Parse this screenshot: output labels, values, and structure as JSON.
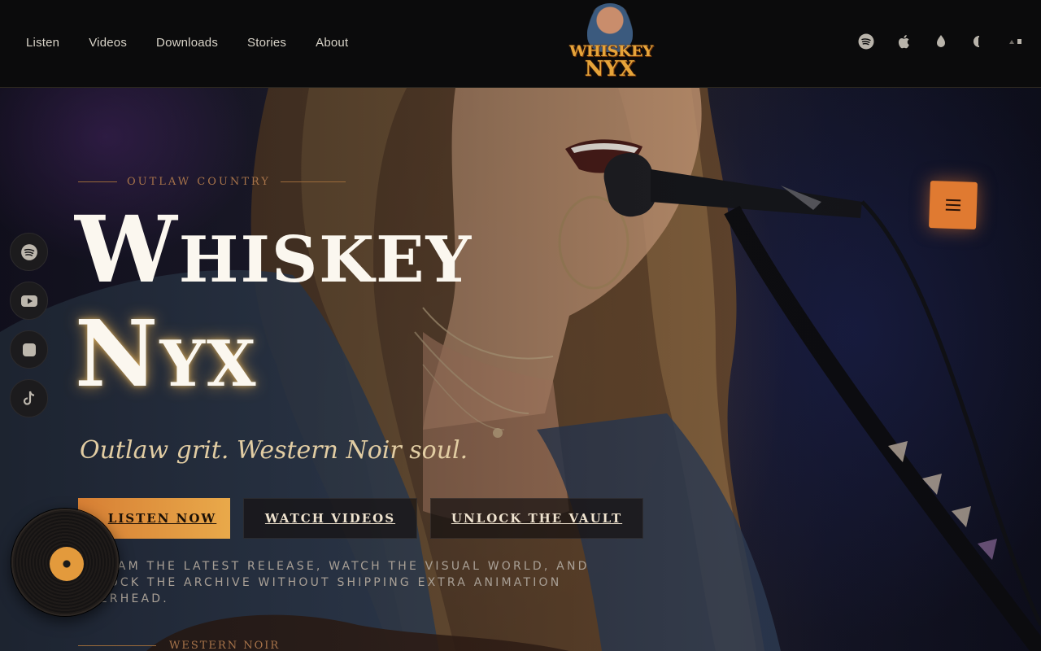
{
  "nav": {
    "links": [
      "Listen",
      "Videos",
      "Downloads",
      "Stories",
      "About"
    ]
  },
  "logo": {
    "line1": "WHISKEY",
    "line2": "NYX"
  },
  "social_top": [
    "spotify-icon",
    "apple-icon",
    "amazon-icon",
    "deezer-icon",
    "more-icon"
  ],
  "hero": {
    "eyebrow": "OUTLAW COUNTRY",
    "title_line1": "Whiskey",
    "title_line2": "Nyx",
    "tagline": "Outlaw grit. Western Noir soul.",
    "buttons": {
      "listen": "LISTEN NOW",
      "videos": "WATCH VIDEOS",
      "vault": "UNLOCK THE VAULT"
    },
    "description": "Stream the latest release, watch the visual world, and unlock the archive without shipping extra animation overhead.",
    "next_section": "WESTERN NOIR"
  },
  "dock": [
    "spotify-icon",
    "youtube-icon",
    "apple-music-icon",
    "tiktok-icon"
  ],
  "colors": {
    "accent": "#e07a31",
    "gold": "#e9a94a",
    "background": "#0b0b0c"
  }
}
